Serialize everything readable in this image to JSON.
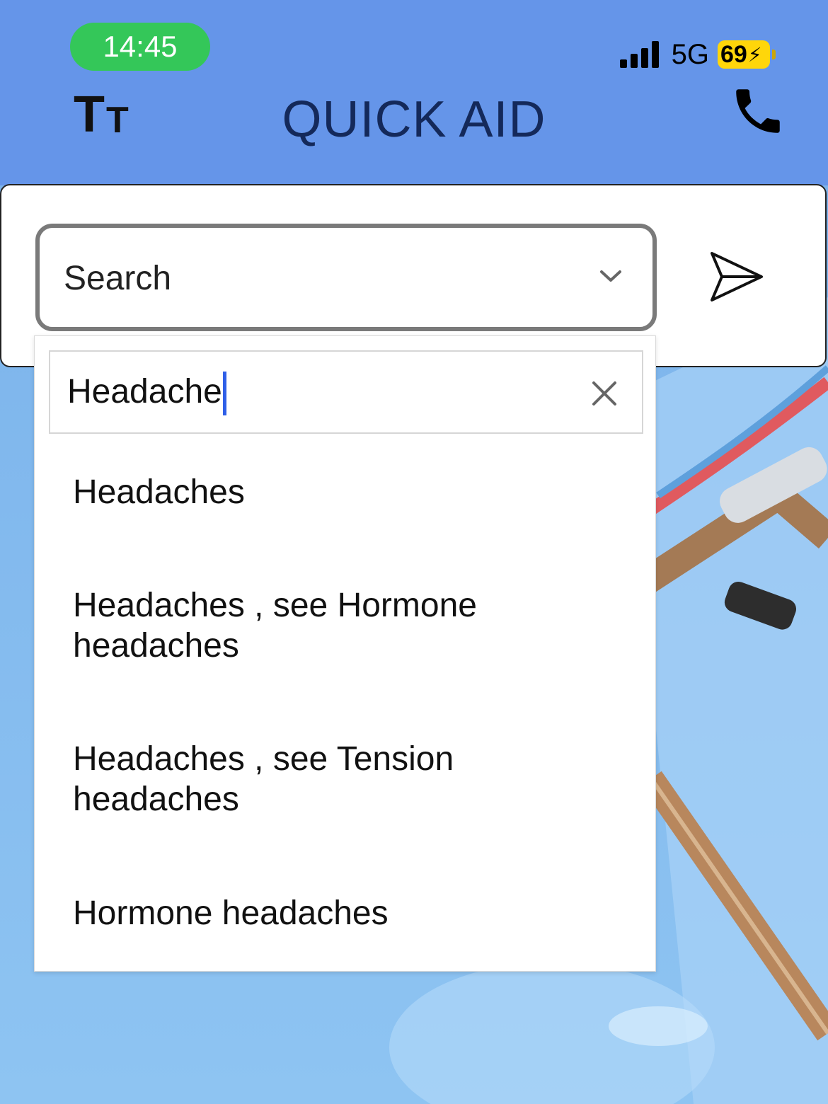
{
  "status_bar": {
    "time": "14:45",
    "network": "5G",
    "battery": "69"
  },
  "header": {
    "title": "QUICK AID"
  },
  "search": {
    "select_label": "Search",
    "filter_value": "Headache",
    "options": [
      "Headaches",
      "Headaches , see Hormone headaches",
      "Headaches , see Tension headaches",
      "Hormone headaches"
    ]
  },
  "colors": {
    "header_bg": "#6595e9",
    "title": "#14295a",
    "time_pill": "#34c759",
    "battery": "#ffd60a",
    "caret": "#2f5fe8"
  },
  "icons": [
    "text-size-icon",
    "phone-icon",
    "chevron-down-icon",
    "send-icon",
    "clear-icon",
    "signal-icon",
    "battery-icon"
  ]
}
